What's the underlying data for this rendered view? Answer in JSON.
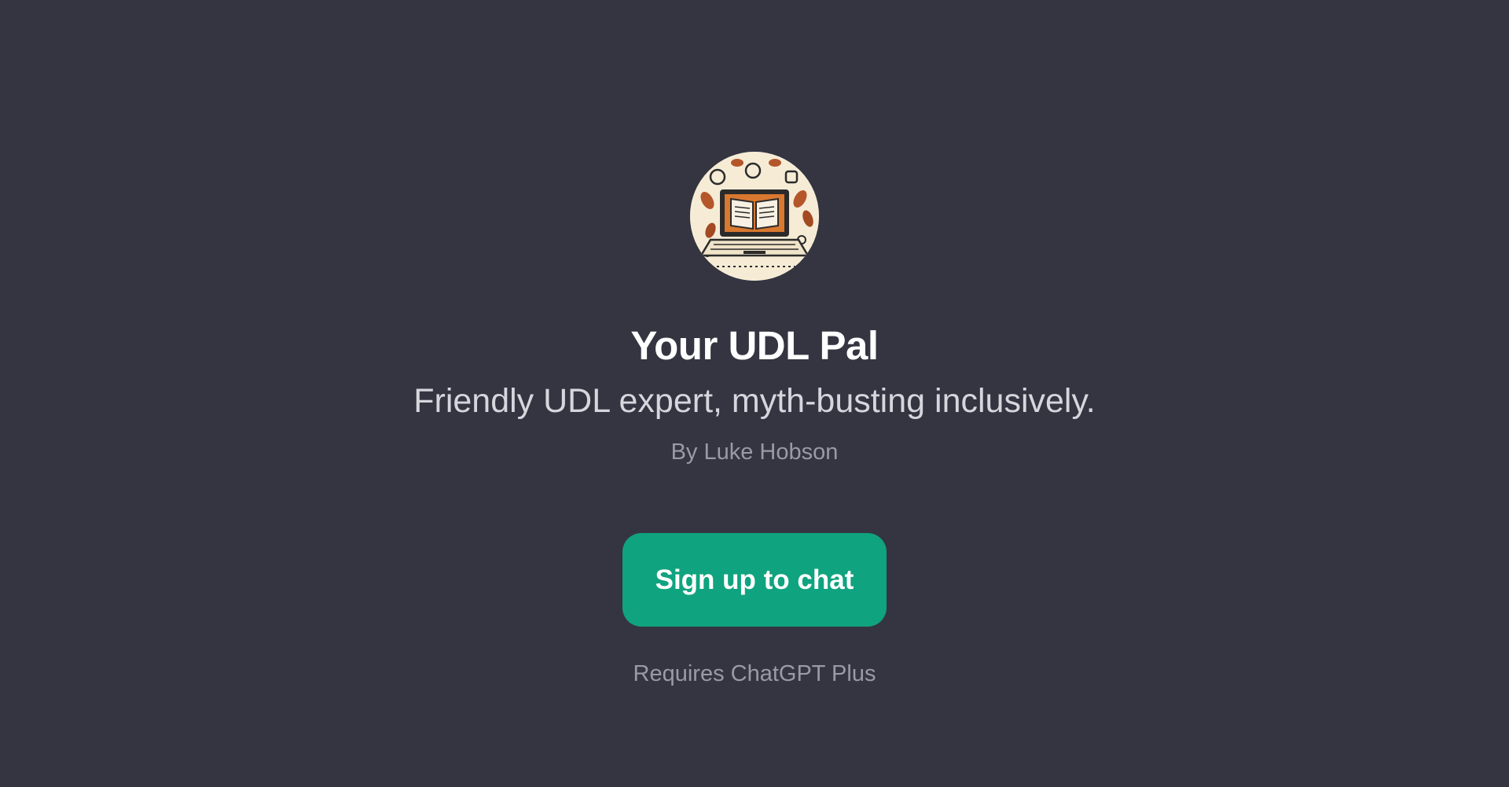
{
  "gpt": {
    "avatar_icon": "book-laptop-icon",
    "title": "Your UDL Pal",
    "description": "Friendly UDL expert, myth-busting inclusively.",
    "byline": "By Luke Hobson"
  },
  "cta": {
    "label": "Sign up to chat",
    "color": "#10a37f"
  },
  "requirement": "Requires ChatGPT Plus",
  "colors": {
    "background": "#343541",
    "title": "#ffffff",
    "subtitle": "#d6d6dd",
    "muted": "#9a9aa6"
  }
}
